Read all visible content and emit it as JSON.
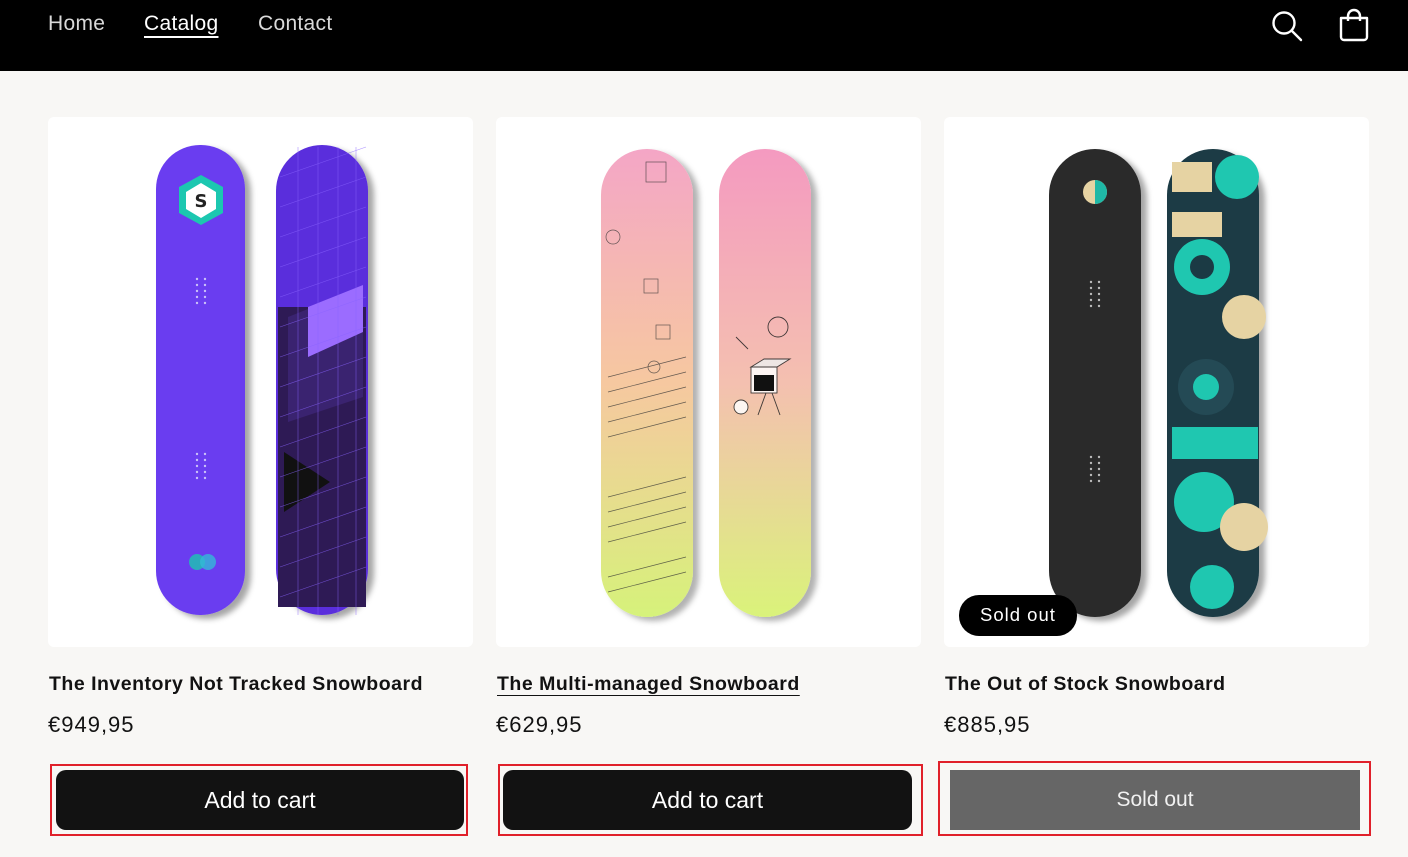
{
  "nav": {
    "items": [
      {
        "label": "Home",
        "active": false
      },
      {
        "label": "Catalog",
        "active": true
      },
      {
        "label": "Contact",
        "active": false
      }
    ],
    "icons": [
      "search-icon",
      "cart-icon"
    ]
  },
  "products": [
    {
      "title": "The Inventory Not Tracked Snowboard",
      "price": "€949,95",
      "button_label": "Add to cart",
      "sold_out": false,
      "colors": [
        "#6a3df0",
        "#5a2fdc"
      ]
    },
    {
      "title": "The Multi-managed Snowboard",
      "price": "€629,95",
      "button_label": "Add to cart",
      "sold_out": false,
      "colors": [
        "#f4a6c6",
        "#d9f27a"
      ]
    },
    {
      "title": "The Out of Stock Snowboard",
      "price": "€885,95",
      "button_label": "Sold out",
      "badge": "Sold out",
      "sold_out": true,
      "colors": [
        "#2a2a2a",
        "#1fc7b0"
      ]
    }
  ],
  "theme": {
    "highlight_border": "#e0202a",
    "button_dark": "#121212",
    "button_disabled": "#666666"
  }
}
